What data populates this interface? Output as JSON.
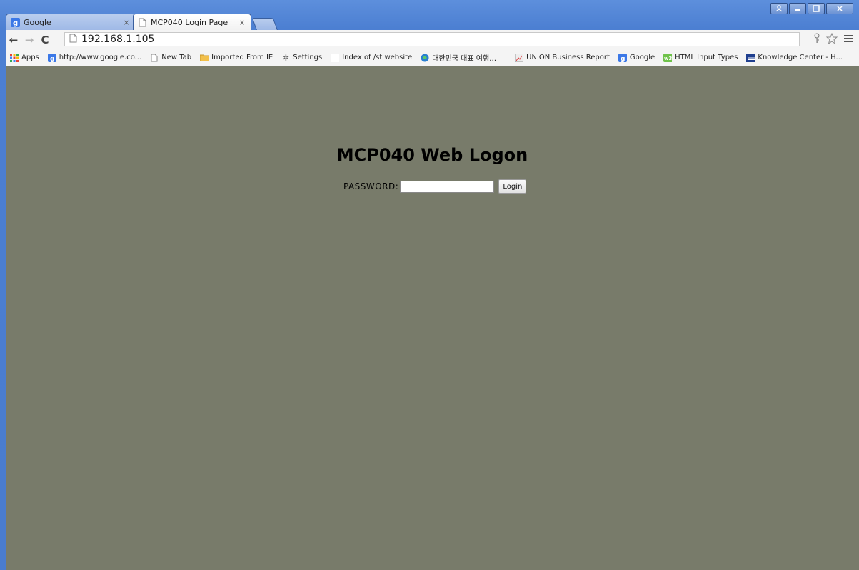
{
  "browser": {
    "tabs": [
      {
        "title": "Google",
        "icon": "google-icon",
        "active": false
      },
      {
        "title": "MCP040 Login Page",
        "icon": "page-icon",
        "active": true
      }
    ],
    "tab_close_glyph": "×",
    "address": "192.168.1.105",
    "bookmarks": [
      {
        "label": "Apps",
        "icon": "apps-grid-icon"
      },
      {
        "label": "http://www.google.co...",
        "icon": "google-icon"
      },
      {
        "label": "New Tab",
        "icon": "page-icon"
      },
      {
        "label": "Imported From IE",
        "icon": "folder-icon"
      },
      {
        "label": "Settings",
        "icon": "gear-icon"
      },
      {
        "label": "Index of /st website",
        "icon": "blank-icon"
      },
      {
        "label": "대한민국 대표 여행…",
        "icon": "globe-icon"
      },
      {
        "label": "UNION Business Report",
        "icon": "report-icon"
      },
      {
        "label": "Google",
        "icon": "google-icon"
      },
      {
        "label": "HTML Input Types",
        "icon": "w3-icon"
      },
      {
        "label": "Knowledge Center - H...",
        "icon": "ibm-icon"
      }
    ]
  },
  "page": {
    "title": "MCP040 Web Logon",
    "password_label": "PASSWORD:",
    "password_value": "",
    "login_button": "Login"
  },
  "colors": {
    "page_background": "#787b6a",
    "window_frame": "#4a78c8"
  }
}
